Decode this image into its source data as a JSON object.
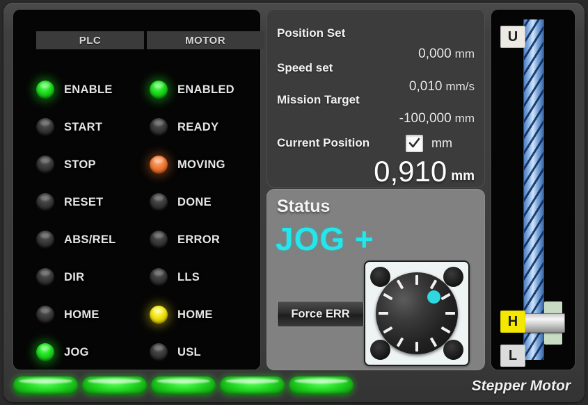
{
  "device": {
    "brand": "Stepper Motor"
  },
  "io": {
    "columns": [
      {
        "header": "PLC"
      },
      {
        "header": "MOTOR"
      }
    ],
    "plc_signals": [
      {
        "label": "ENABLE",
        "state": "green"
      },
      {
        "label": "START",
        "state": "off"
      },
      {
        "label": "STOP",
        "state": "off"
      },
      {
        "label": "RESET",
        "state": "off"
      },
      {
        "label": "ABS/REL",
        "state": "off"
      },
      {
        "label": "DIR",
        "state": "off"
      },
      {
        "label": "HOME",
        "state": "off"
      },
      {
        "label": "JOG",
        "state": "green"
      }
    ],
    "motor_signals": [
      {
        "label": "ENABLED",
        "state": "green"
      },
      {
        "label": "READY",
        "state": "off"
      },
      {
        "label": "MOVING",
        "state": "orange"
      },
      {
        "label": "DONE",
        "state": "off"
      },
      {
        "label": "ERROR",
        "state": "off"
      },
      {
        "label": "LLS",
        "state": "off"
      },
      {
        "label": "HOME",
        "state": "yellow"
      },
      {
        "label": "USL",
        "state": "off"
      }
    ]
  },
  "readout": {
    "position_set": {
      "label": "Position Set",
      "value": "0,000",
      "unit": "mm"
    },
    "speed_set": {
      "label": "Speed set",
      "value": "0,010",
      "unit": "mm/s"
    },
    "mission_target": {
      "label": "Mission Target",
      "value": "-100,000",
      "unit": "mm"
    },
    "current_position": {
      "label": "Current Position",
      "unit_checkbox_checked": true,
      "unit_label": "mm",
      "value": "0,910",
      "unit": "mm"
    }
  },
  "status": {
    "title": "Status",
    "value": "JOG +",
    "value_color": "#22e8ee",
    "force_err_button": "Force ERR",
    "jog_knob": {
      "name": "jog-knob",
      "tick_count": 12,
      "indicator_color": "#2fd8e0",
      "indicator_angle_deg": 45
    }
  },
  "axis": {
    "upper_limit_tag": "U",
    "home_tag": "H",
    "lower_limit_tag": "L",
    "home_tag_color": "#f5e800"
  },
  "bottom_indicators": [
    {
      "name": "indicator-1",
      "state": "green"
    },
    {
      "name": "indicator-2",
      "state": "green"
    },
    {
      "name": "indicator-3",
      "state": "green"
    },
    {
      "name": "indicator-4",
      "state": "green"
    },
    {
      "name": "indicator-5",
      "state": "green"
    }
  ]
}
